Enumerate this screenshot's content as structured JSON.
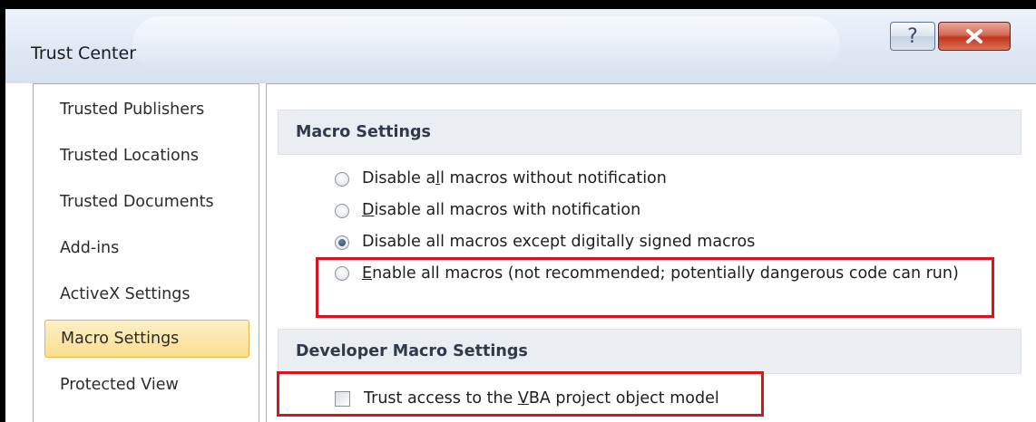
{
  "window": {
    "title": "Trust Center",
    "help_glyph": "?",
    "close_glyph": "x"
  },
  "sidebar": {
    "items": [
      {
        "label": "Trusted Publishers",
        "selected": false
      },
      {
        "label": "Trusted Locations",
        "selected": false
      },
      {
        "label": "Trusted Documents",
        "selected": false
      },
      {
        "label": "Add-ins",
        "selected": false
      },
      {
        "label": "ActiveX Settings",
        "selected": false
      },
      {
        "label": "Macro Settings",
        "selected": true
      },
      {
        "label": "Protected View",
        "selected": false
      }
    ]
  },
  "macro_settings": {
    "heading": "Macro Settings",
    "options": [
      {
        "pre": "Disable a",
        "key": "l",
        "post": "l macros without notification",
        "checked": false
      },
      {
        "pre": "",
        "key": "D",
        "post": "isable all macros with notification",
        "checked": false
      },
      {
        "pre": "Disable all macros except di",
        "key": "g",
        "post": "itally signed macros",
        "checked": true
      },
      {
        "pre": "",
        "key": "E",
        "post": "nable all macros (not recommended; potentially dangerous code can run)",
        "checked": false
      }
    ]
  },
  "developer": {
    "heading": "Developer Macro Settings",
    "checkbox": {
      "pre": "Trust access to the ",
      "key": "V",
      "post": "BA project object model",
      "checked": false
    }
  },
  "colors": {
    "highlight_border": "#d9141b",
    "selected_nav": "#fbdd8c",
    "section_header": "#eaedf2"
  }
}
